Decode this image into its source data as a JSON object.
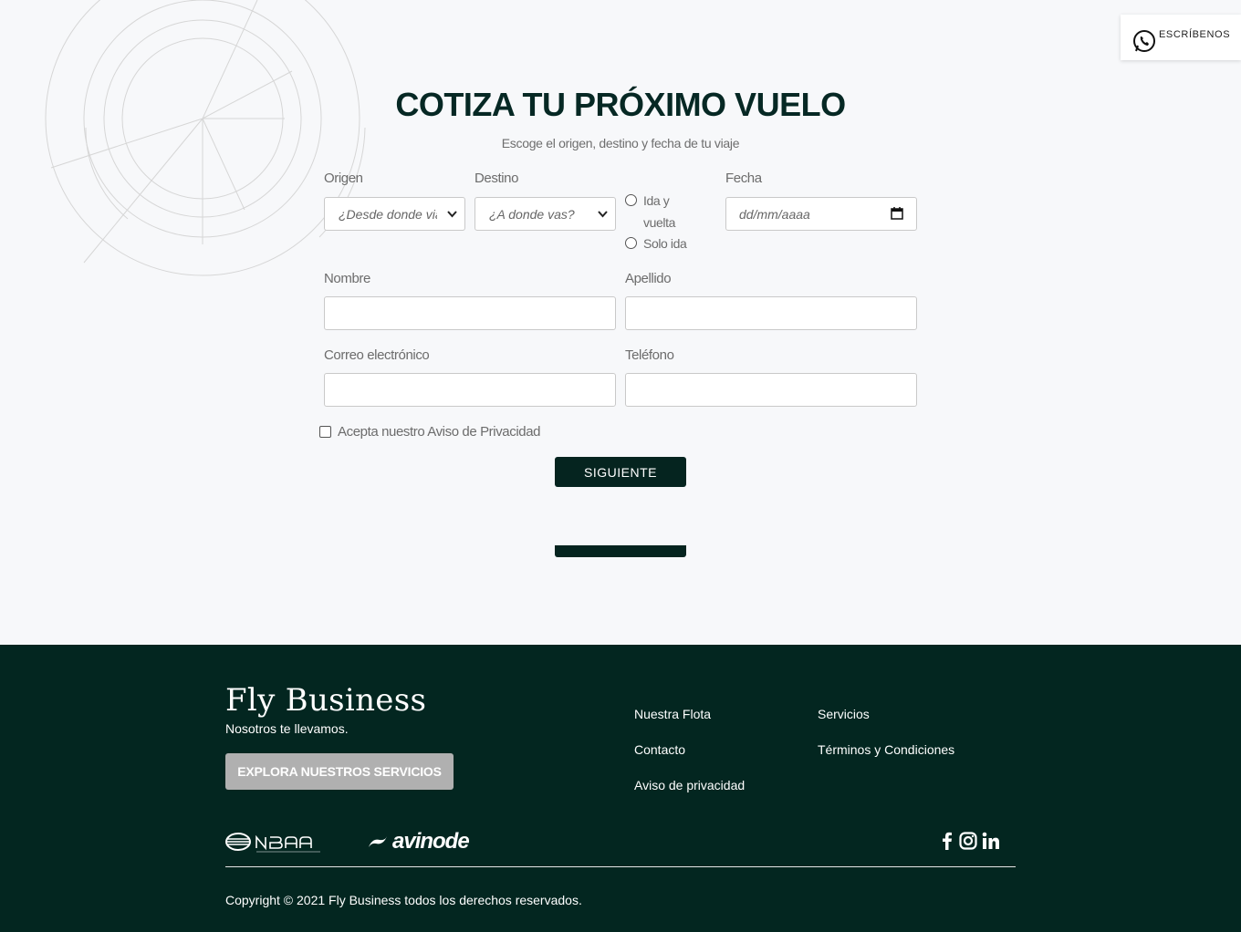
{
  "whatsapp": {
    "label": "ESCRÍBENOS",
    "icon": "whatsapp-icon"
  },
  "form": {
    "title": "COTIZA TU PRÓXIMO VUELO",
    "subtitle": "Escoge el origen, destino y fecha de tu viaje",
    "origin": {
      "label": "Origen",
      "selected": "¿Desde donde viajas?"
    },
    "destination": {
      "label": "Destino",
      "selected": "¿A donde vas?"
    },
    "trip_type": {
      "round_trip_line1": "Ida y",
      "round_trip_line2": "vuelta",
      "one_way": "Solo ida"
    },
    "date": {
      "label": "Fecha",
      "placeholder": "dd/mm/aaaa"
    },
    "first_name": {
      "label": "Nombre",
      "value": ""
    },
    "last_name": {
      "label": "Apellido",
      "value": ""
    },
    "email": {
      "label": "Correo electrónico",
      "value": ""
    },
    "phone": {
      "label": "Teléfono",
      "value": ""
    },
    "privacy_checkbox": "Acepta nuestro Aviso de Privacidad",
    "next_button": "SIGUIENTE"
  },
  "footer": {
    "brand": "Fly Business",
    "tagline": "Nosotros te llevamos.",
    "explore_button": "EXPLORA NUESTROS SERVICIOS",
    "links": {
      "fleet": "Nuestra Flota",
      "services": "Servicios",
      "contact": "Contacto",
      "terms": "Términos y Condiciones",
      "privacy": "Aviso de privacidad"
    },
    "partners": {
      "nbaa": "NBAA",
      "avinode": "avinode"
    },
    "social_icons": [
      "facebook-icon",
      "instagram-icon",
      "linkedin-icon"
    ],
    "copyright": "Copyright © 2021 Fly Business todos los derechos reservados."
  },
  "colors": {
    "primary": "#05241f",
    "footer_bg": "#032620",
    "explore_button": "#b0b0b0"
  }
}
